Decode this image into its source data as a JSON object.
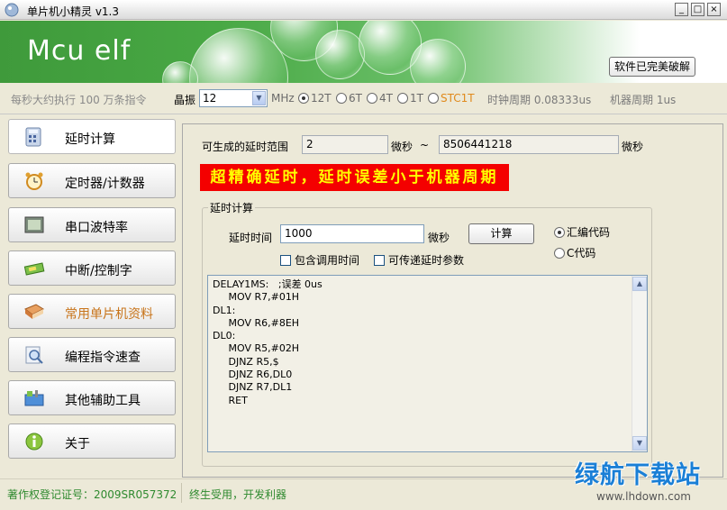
{
  "window": {
    "title": "单片机小精灵  v1.3",
    "controls": [
      "_",
      "□",
      "×"
    ]
  },
  "banner": {
    "brand": "Mcu elf",
    "crack_button": "软件已完美破解"
  },
  "options": {
    "speed_text": "每秒大约执行 100 万条指令",
    "osc_label": "晶振",
    "osc_value": "12",
    "osc_unit": "MHz",
    "modes": [
      {
        "label": "12T",
        "selected": true
      },
      {
        "label": "6T",
        "selected": false
      },
      {
        "label": "4T",
        "selected": false
      },
      {
        "label": "1T",
        "selected": false
      },
      {
        "label": "STC1T",
        "selected": false
      }
    ],
    "clock_cycle": "时钟周期 0.08333us",
    "machine_cycle": "机器周期 1us"
  },
  "sidebar": {
    "items": [
      {
        "label": "延时计算",
        "icon": "calculator-icon",
        "active": true
      },
      {
        "label": "定时器/计数器",
        "icon": "alarm-clock-icon",
        "active": false
      },
      {
        "label": "串口波特率",
        "icon": "serial-port-icon",
        "active": false
      },
      {
        "label": "中断/控制字",
        "icon": "chip-icon",
        "active": false
      },
      {
        "label": "常用单片机资料",
        "icon": "book-icon",
        "active": false,
        "highlight": true
      },
      {
        "label": "编程指令速查",
        "icon": "magnifier-icon",
        "active": false
      },
      {
        "label": "其他辅助工具",
        "icon": "toolbox-icon",
        "active": false
      },
      {
        "label": "关于",
        "icon": "info-icon",
        "active": false
      }
    ]
  },
  "main": {
    "range_label": "可生成的延时范围",
    "range_min": "2",
    "range_unit_1": "微秒",
    "range_sep": "~",
    "range_max": "8506441218",
    "range_unit_2": "微秒",
    "highlight_text": "超精确延时，延时误差小于机器周期",
    "group_title": "延时计算",
    "delay_label": "延时时间",
    "delay_value": "1000",
    "delay_unit": "微秒",
    "calc_button": "计算",
    "include_call": "包含调用时间",
    "pass_param": "可传递延时参数",
    "lang_asm": "汇编代码",
    "lang_c": "C代码",
    "code": "DELAY1MS:   ;误差 0us\n     MOV R7,#01H\nDL1:\n     MOV R6,#8EH\nDL0:\n     MOV R5,#02H\n     DJNZ R5,$\n     DJNZ R6,DL0\n     DJNZ R7,DL1\n     RET"
  },
  "status": {
    "registration": "著作权登记证号：2009SR057372",
    "slogan": "终生受用，开发利器"
  },
  "watermark": {
    "big": "绿航下载站",
    "small": "www.lhdown.com"
  },
  "colors": {
    "accent_green": "#48a844",
    "alert_red": "#f40000",
    "alert_text": "#ffff00",
    "status_green": "#2f8a2f"
  }
}
